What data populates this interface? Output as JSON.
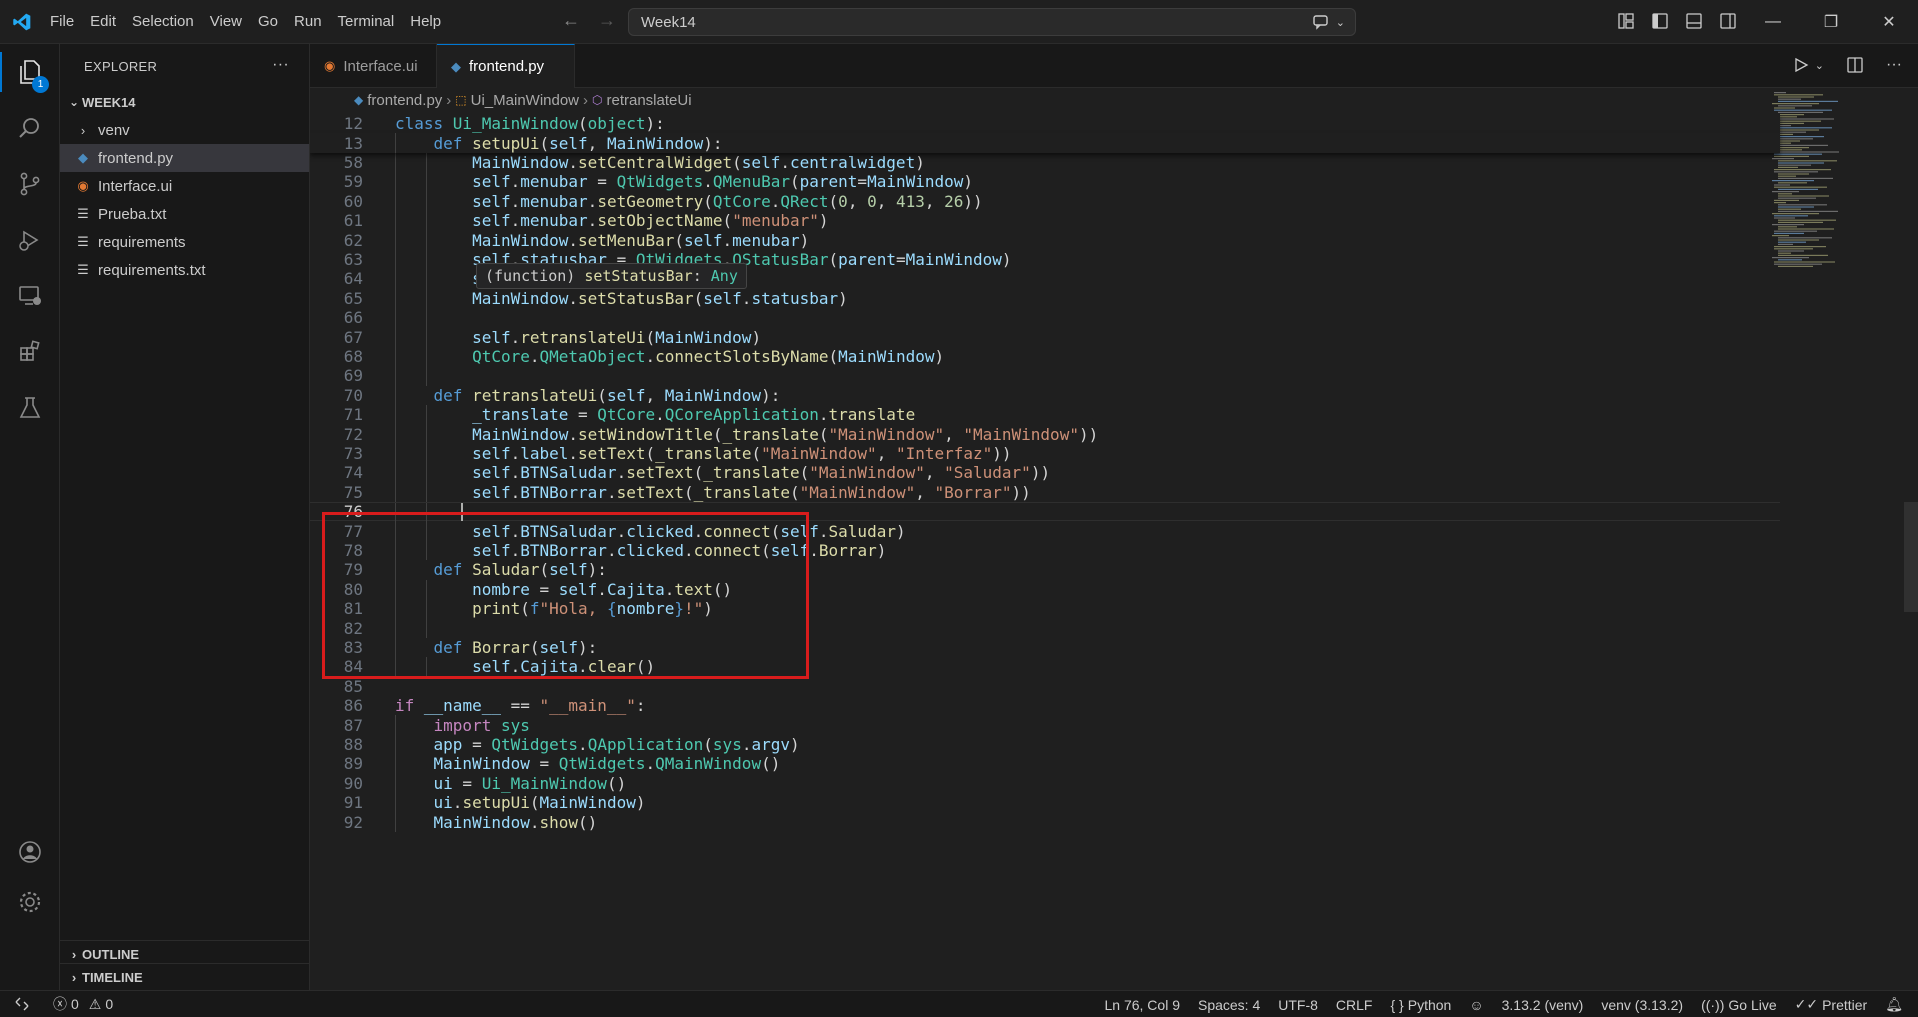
{
  "titlebar": {
    "menus": [
      "File",
      "Edit",
      "Selection",
      "View",
      "Go",
      "Run",
      "Terminal",
      "Help"
    ],
    "search_text": "Week14"
  },
  "activity": {
    "explorer_badge": "1"
  },
  "sidebar": {
    "title": "EXPLORER",
    "workspace": "WEEK14",
    "items": [
      {
        "label": "venv",
        "kind": "folder"
      },
      {
        "label": "frontend.py",
        "kind": "python",
        "selected": true
      },
      {
        "label": "Interface.ui",
        "kind": "rss"
      },
      {
        "label": "Prueba.txt",
        "kind": "text"
      },
      {
        "label": "requirements",
        "kind": "text"
      },
      {
        "label": "requirements.txt",
        "kind": "text"
      }
    ],
    "outline": "OUTLINE",
    "timeline": "TIMELINE"
  },
  "tabs": [
    {
      "label": "Interface.ui",
      "icon": "rss-icon",
      "active": false
    },
    {
      "label": "frontend.py",
      "icon": "python-icon",
      "active": true,
      "dirty": true
    }
  ],
  "breadcrumb": {
    "file": "frontend.py",
    "class": "Ui_MainWindow",
    "method": "retranslateUi"
  },
  "hover": {
    "prefix": "(function)",
    "name": "setStatusBar",
    "type": "Any"
  },
  "code": [
    {
      "n": "12",
      "sticky": true,
      "t": [
        [
          "kw",
          "class "
        ],
        [
          "cls",
          "Ui_MainWindow"
        ],
        [
          "plain",
          "("
        ],
        [
          "cls",
          "object"
        ],
        [
          "plain",
          "):"
        ]
      ]
    },
    {
      "n": "13",
      "sticky": true,
      "t": [
        [
          "plain",
          "    "
        ],
        [
          "kw",
          "def "
        ],
        [
          "fn",
          "setupUi"
        ],
        [
          "plain",
          "("
        ],
        [
          "par",
          "self"
        ],
        [
          "plain",
          ", "
        ],
        [
          "par",
          "MainWindow"
        ],
        [
          "plain",
          "):"
        ]
      ]
    },
    {
      "n": "58",
      "t": [
        [
          "plain",
          "        "
        ],
        [
          "var",
          "MainWindow"
        ],
        [
          "plain",
          "."
        ],
        [
          "fn",
          "setCentralWidget"
        ],
        [
          "plain",
          "("
        ],
        [
          "var",
          "self"
        ],
        [
          "plain",
          "."
        ],
        [
          "var",
          "centralwidget"
        ],
        [
          "plain",
          ")"
        ]
      ]
    },
    {
      "n": "59",
      "t": [
        [
          "plain",
          "        "
        ],
        [
          "var",
          "self"
        ],
        [
          "plain",
          "."
        ],
        [
          "var",
          "menubar"
        ],
        [
          "plain",
          " = "
        ],
        [
          "cls",
          "QtWidgets"
        ],
        [
          "plain",
          "."
        ],
        [
          "cls",
          "QMenuBar"
        ],
        [
          "plain",
          "("
        ],
        [
          "par",
          "parent"
        ],
        [
          "plain",
          "="
        ],
        [
          "var",
          "MainWindow"
        ],
        [
          "plain",
          ")"
        ]
      ]
    },
    {
      "n": "60",
      "t": [
        [
          "plain",
          "        "
        ],
        [
          "var",
          "self"
        ],
        [
          "plain",
          "."
        ],
        [
          "var",
          "menubar"
        ],
        [
          "plain",
          "."
        ],
        [
          "fn",
          "setGeometry"
        ],
        [
          "plain",
          "("
        ],
        [
          "cls",
          "QtCore"
        ],
        [
          "plain",
          "."
        ],
        [
          "cls",
          "QRect"
        ],
        [
          "plain",
          "("
        ],
        [
          "num",
          "0"
        ],
        [
          "plain",
          ", "
        ],
        [
          "num",
          "0"
        ],
        [
          "plain",
          ", "
        ],
        [
          "num",
          "413"
        ],
        [
          "plain",
          ", "
        ],
        [
          "num",
          "26"
        ],
        [
          "plain",
          "))"
        ]
      ]
    },
    {
      "n": "61",
      "t": [
        [
          "plain",
          "        "
        ],
        [
          "var",
          "self"
        ],
        [
          "plain",
          "."
        ],
        [
          "var",
          "menubar"
        ],
        [
          "plain",
          "."
        ],
        [
          "fn",
          "setObjectName"
        ],
        [
          "plain",
          "("
        ],
        [
          "str",
          "\"menubar\""
        ],
        [
          "plain",
          ")"
        ]
      ]
    },
    {
      "n": "62",
      "t": [
        [
          "plain",
          "        "
        ],
        [
          "var",
          "MainWindow"
        ],
        [
          "plain",
          "."
        ],
        [
          "fn",
          "setMenuBar"
        ],
        [
          "plain",
          "("
        ],
        [
          "var",
          "self"
        ],
        [
          "plain",
          "."
        ],
        [
          "var",
          "menubar"
        ],
        [
          "plain",
          ")"
        ]
      ]
    },
    {
      "n": "63",
      "t": [
        [
          "plain",
          "        "
        ],
        [
          "var",
          "self"
        ],
        [
          "plain",
          "."
        ],
        [
          "var",
          "statusbar"
        ],
        [
          "plain",
          " = "
        ],
        [
          "cls",
          "QtWidgets"
        ],
        [
          "plain",
          "."
        ],
        [
          "cls",
          "QStatusBar"
        ],
        [
          "plain",
          "("
        ],
        [
          "par",
          "parent"
        ],
        [
          "plain",
          "="
        ],
        [
          "var",
          "MainWindow"
        ],
        [
          "plain",
          ")"
        ]
      ]
    },
    {
      "n": "64",
      "t": [
        [
          "plain",
          "        "
        ],
        [
          "var",
          "self"
        ],
        [
          "plain",
          "."
        ],
        [
          "var",
          "status"
        ]
      ]
    },
    {
      "n": "65",
      "t": [
        [
          "plain",
          "        "
        ],
        [
          "var",
          "MainWindow"
        ],
        [
          "plain",
          "."
        ],
        [
          "fn",
          "setStatusBar"
        ],
        [
          "plain",
          "("
        ],
        [
          "var",
          "self"
        ],
        [
          "plain",
          "."
        ],
        [
          "var",
          "statusbar"
        ],
        [
          "plain",
          ")"
        ]
      ]
    },
    {
      "n": "66",
      "t": []
    },
    {
      "n": "67",
      "t": [
        [
          "plain",
          "        "
        ],
        [
          "var",
          "self"
        ],
        [
          "plain",
          "."
        ],
        [
          "fn",
          "retranslateUi"
        ],
        [
          "plain",
          "("
        ],
        [
          "var",
          "MainWindow"
        ],
        [
          "plain",
          ")"
        ]
      ]
    },
    {
      "n": "68",
      "t": [
        [
          "plain",
          "        "
        ],
        [
          "cls",
          "QtCore"
        ],
        [
          "plain",
          "."
        ],
        [
          "cls",
          "QMetaObject"
        ],
        [
          "plain",
          "."
        ],
        [
          "fn",
          "connectSlotsByName"
        ],
        [
          "plain",
          "("
        ],
        [
          "var",
          "MainWindow"
        ],
        [
          "plain",
          ")"
        ]
      ]
    },
    {
      "n": "69",
      "t": []
    },
    {
      "n": "70",
      "t": [
        [
          "plain",
          "    "
        ],
        [
          "kw",
          "def "
        ],
        [
          "fn",
          "retranslateUi"
        ],
        [
          "plain",
          "("
        ],
        [
          "par",
          "self"
        ],
        [
          "plain",
          ", "
        ],
        [
          "par",
          "MainWindow"
        ],
        [
          "plain",
          "):"
        ]
      ]
    },
    {
      "n": "71",
      "t": [
        [
          "plain",
          "        "
        ],
        [
          "var",
          "_translate"
        ],
        [
          "plain",
          " = "
        ],
        [
          "cls",
          "QtCore"
        ],
        [
          "plain",
          "."
        ],
        [
          "cls",
          "QCoreApplication"
        ],
        [
          "plain",
          "."
        ],
        [
          "fn",
          "translate"
        ]
      ]
    },
    {
      "n": "72",
      "t": [
        [
          "plain",
          "        "
        ],
        [
          "var",
          "MainWindow"
        ],
        [
          "plain",
          "."
        ],
        [
          "fn",
          "setWindowTitle"
        ],
        [
          "plain",
          "("
        ],
        [
          "fn",
          "_translate"
        ],
        [
          "plain",
          "("
        ],
        [
          "str",
          "\"MainWindow\""
        ],
        [
          "plain",
          ", "
        ],
        [
          "str",
          "\"MainWindow\""
        ],
        [
          "plain",
          "))"
        ]
      ]
    },
    {
      "n": "73",
      "t": [
        [
          "plain",
          "        "
        ],
        [
          "var",
          "self"
        ],
        [
          "plain",
          "."
        ],
        [
          "var",
          "label"
        ],
        [
          "plain",
          "."
        ],
        [
          "fn",
          "setText"
        ],
        [
          "plain",
          "("
        ],
        [
          "fn",
          "_translate"
        ],
        [
          "plain",
          "("
        ],
        [
          "str",
          "\"MainWindow\""
        ],
        [
          "plain",
          ", "
        ],
        [
          "str",
          "\"Interfaz\""
        ],
        [
          "plain",
          "))"
        ]
      ]
    },
    {
      "n": "74",
      "t": [
        [
          "plain",
          "        "
        ],
        [
          "var",
          "self"
        ],
        [
          "plain",
          "."
        ],
        [
          "var",
          "BTNSaludar"
        ],
        [
          "plain",
          "."
        ],
        [
          "fn",
          "setText"
        ],
        [
          "plain",
          "("
        ],
        [
          "fn",
          "_translate"
        ],
        [
          "plain",
          "("
        ],
        [
          "str",
          "\"MainWindow\""
        ],
        [
          "plain",
          ", "
        ],
        [
          "str",
          "\"Saludar\""
        ],
        [
          "plain",
          "))"
        ]
      ]
    },
    {
      "n": "75",
      "t": [
        [
          "plain",
          "        "
        ],
        [
          "var",
          "self"
        ],
        [
          "plain",
          "."
        ],
        [
          "var",
          "BTNBorrar"
        ],
        [
          "plain",
          "."
        ],
        [
          "fn",
          "setText"
        ],
        [
          "plain",
          "("
        ],
        [
          "fn",
          "_translate"
        ],
        [
          "plain",
          "("
        ],
        [
          "str",
          "\"MainWindow\""
        ],
        [
          "plain",
          ", "
        ],
        [
          "str",
          "\"Borrar\""
        ],
        [
          "plain",
          "))"
        ]
      ]
    },
    {
      "n": "76",
      "current": true,
      "t": []
    },
    {
      "n": "77",
      "t": [
        [
          "plain",
          "        "
        ],
        [
          "var",
          "self"
        ],
        [
          "plain",
          "."
        ],
        [
          "var",
          "BTNSaludar"
        ],
        [
          "plain",
          "."
        ],
        [
          "var",
          "clicked"
        ],
        [
          "plain",
          "."
        ],
        [
          "fn",
          "connect"
        ],
        [
          "plain",
          "("
        ],
        [
          "var",
          "self"
        ],
        [
          "plain",
          "."
        ],
        [
          "fn",
          "Saludar"
        ],
        [
          "plain",
          ")"
        ]
      ]
    },
    {
      "n": "78",
      "t": [
        [
          "plain",
          "        "
        ],
        [
          "var",
          "self"
        ],
        [
          "plain",
          "."
        ],
        [
          "var",
          "BTNBorrar"
        ],
        [
          "plain",
          "."
        ],
        [
          "var",
          "clicked"
        ],
        [
          "plain",
          "."
        ],
        [
          "fn",
          "connect"
        ],
        [
          "plain",
          "("
        ],
        [
          "var",
          "self"
        ],
        [
          "plain",
          "."
        ],
        [
          "fn",
          "Borrar"
        ],
        [
          "plain",
          ")"
        ]
      ]
    },
    {
      "n": "79",
      "t": [
        [
          "plain",
          "    "
        ],
        [
          "kw",
          "def "
        ],
        [
          "fn",
          "Saludar"
        ],
        [
          "plain",
          "("
        ],
        [
          "par",
          "self"
        ],
        [
          "plain",
          "):"
        ]
      ]
    },
    {
      "n": "80",
      "t": [
        [
          "plain",
          "        "
        ],
        [
          "var",
          "nombre"
        ],
        [
          "plain",
          " = "
        ],
        [
          "var",
          "self"
        ],
        [
          "plain",
          "."
        ],
        [
          "var",
          "Cajita"
        ],
        [
          "plain",
          "."
        ],
        [
          "fn",
          "text"
        ],
        [
          "plain",
          "()"
        ]
      ]
    },
    {
      "n": "81",
      "t": [
        [
          "plain",
          "        "
        ],
        [
          "fn",
          "print"
        ],
        [
          "plain",
          "("
        ],
        [
          "kw",
          "f"
        ],
        [
          "str",
          "\"Hola, "
        ],
        [
          "kw",
          "{"
        ],
        [
          "var",
          "nombre"
        ],
        [
          "kw",
          "}"
        ],
        [
          "str",
          "!\""
        ],
        [
          "plain",
          ")"
        ]
      ]
    },
    {
      "n": "82",
      "t": []
    },
    {
      "n": "83",
      "t": [
        [
          "plain",
          "    "
        ],
        [
          "kw",
          "def "
        ],
        [
          "fn",
          "Borrar"
        ],
        [
          "plain",
          "("
        ],
        [
          "par",
          "self"
        ],
        [
          "plain",
          "):"
        ]
      ]
    },
    {
      "n": "84",
      "t": [
        [
          "plain",
          "        "
        ],
        [
          "var",
          "self"
        ],
        [
          "plain",
          "."
        ],
        [
          "var",
          "Cajita"
        ],
        [
          "plain",
          "."
        ],
        [
          "fn",
          "clear"
        ],
        [
          "plain",
          "()"
        ]
      ]
    },
    {
      "n": "85",
      "t": []
    },
    {
      "n": "86",
      "t": [
        [
          "k1",
          "if "
        ],
        [
          "var",
          "__name__"
        ],
        [
          "plain",
          " == "
        ],
        [
          "str",
          "\"__main__\""
        ],
        [
          "plain",
          ":"
        ]
      ]
    },
    {
      "n": "87",
      "t": [
        [
          "plain",
          "    "
        ],
        [
          "k1",
          "import "
        ],
        [
          "cls",
          "sys"
        ]
      ]
    },
    {
      "n": "88",
      "t": [
        [
          "plain",
          "    "
        ],
        [
          "var",
          "app"
        ],
        [
          "plain",
          " = "
        ],
        [
          "cls",
          "QtWidgets"
        ],
        [
          "plain",
          "."
        ],
        [
          "cls",
          "QApplication"
        ],
        [
          "plain",
          "("
        ],
        [
          "cls",
          "sys"
        ],
        [
          "plain",
          "."
        ],
        [
          "var",
          "argv"
        ],
        [
          "plain",
          ")"
        ]
      ]
    },
    {
      "n": "89",
      "t": [
        [
          "plain",
          "    "
        ],
        [
          "var",
          "MainWindow"
        ],
        [
          "plain",
          " = "
        ],
        [
          "cls",
          "QtWidgets"
        ],
        [
          "plain",
          "."
        ],
        [
          "cls",
          "QMainWindow"
        ],
        [
          "plain",
          "()"
        ]
      ]
    },
    {
      "n": "90",
      "t": [
        [
          "plain",
          "    "
        ],
        [
          "var",
          "ui"
        ],
        [
          "plain",
          " = "
        ],
        [
          "cls",
          "Ui_MainWindow"
        ],
        [
          "plain",
          "()"
        ]
      ]
    },
    {
      "n": "91",
      "t": [
        [
          "plain",
          "    "
        ],
        [
          "var",
          "ui"
        ],
        [
          "plain",
          "."
        ],
        [
          "fn",
          "setupUi"
        ],
        [
          "plain",
          "("
        ],
        [
          "var",
          "MainWindow"
        ],
        [
          "plain",
          ")"
        ]
      ]
    },
    {
      "n": "92",
      "t": [
        [
          "plain",
          "    "
        ],
        [
          "var",
          "MainWindow"
        ],
        [
          "plain",
          "."
        ],
        [
          "fn",
          "show"
        ],
        [
          "plain",
          "()"
        ]
      ]
    }
  ],
  "status": {
    "errors": "0",
    "warnings": "0",
    "position": "Ln 76, Col 9",
    "spaces": "Spaces: 4",
    "encoding": "UTF-8",
    "eol": "CRLF",
    "language": "Python",
    "python_version": "3.13.2 (venv)",
    "venv": "venv (3.13.2)",
    "golive": "Go Live",
    "prettier": "Prettier"
  },
  "colors": {
    "accent": "#0078d4",
    "highlight_box": "#d81c1c"
  }
}
